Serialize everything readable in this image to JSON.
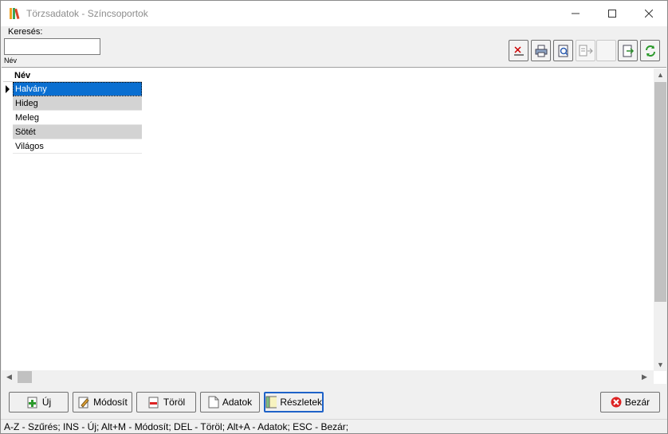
{
  "window": {
    "title": "Törzsadatok - Színcsoportok"
  },
  "search": {
    "label": "Keresés:",
    "value": "",
    "field_label": "Név"
  },
  "grid": {
    "column_header": "Név",
    "rows": [
      "Halvány",
      "Hideg",
      "Meleg",
      "Sötét",
      "Világos"
    ],
    "selected_index": 0
  },
  "toolbar": {
    "buttons": [
      {
        "icon": "clear-filter-icon",
        "enabled": true
      },
      {
        "icon": "print-icon",
        "enabled": true
      },
      {
        "icon": "print-preview-icon",
        "enabled": true
      },
      {
        "icon": "export-doc-icon",
        "enabled": false
      },
      {
        "icon": "blank-icon",
        "enabled": false
      },
      {
        "icon": "export-arrow-icon",
        "enabled": true
      },
      {
        "icon": "refresh-icon",
        "enabled": true
      }
    ]
  },
  "actions": {
    "new_label": "Új",
    "modify_label": "Módosít",
    "delete_label": "Töröl",
    "data_label": "Adatok",
    "details_label": "Részletek",
    "close_label": "Bezár"
  },
  "status": {
    "text": "A-Z - Szűrés; INS - Új; Alt+M - Módosít; DEL - Töröl; Alt+A - Adatok; ESC - Bezár;"
  },
  "colors": {
    "selection": "#0a6fd1",
    "alt_row": "#d3d3d3",
    "focus_border": "#1e62c8"
  }
}
